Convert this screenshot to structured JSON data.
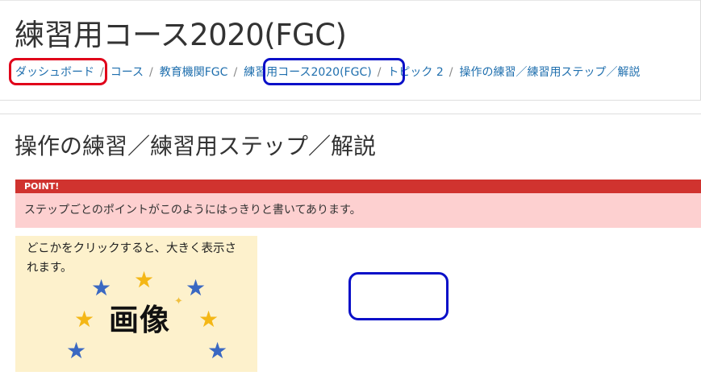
{
  "course": {
    "title": "練習用コース2020(FGC)"
  },
  "breadcrumb": {
    "items": [
      {
        "label": "ダッシュボード"
      },
      {
        "label": "コース"
      },
      {
        "label": "教育機関FGC"
      },
      {
        "label": "練習用コース2020(FGC)"
      },
      {
        "label": "トピック 2"
      },
      {
        "label": "操作の練習／練習用ステップ／解説"
      }
    ],
    "separator": "/"
  },
  "page": {
    "heading": "操作の練習／練習用ステップ／解説"
  },
  "point": {
    "header": "POINT!",
    "body": "ステップごとのポイントがこのようにはっきりと書いてあります。"
  },
  "image_card": {
    "caption": "どこかをクリックすると、大きく表示されます。",
    "label": "画像"
  },
  "colors": {
    "link": "#1f6fae",
    "point_header": "#d0332f",
    "point_body": "#fdd0d0",
    "highlight_red": "#e0001a",
    "highlight_blue": "#0a10c8",
    "image_bg": "#fdf1cc"
  }
}
